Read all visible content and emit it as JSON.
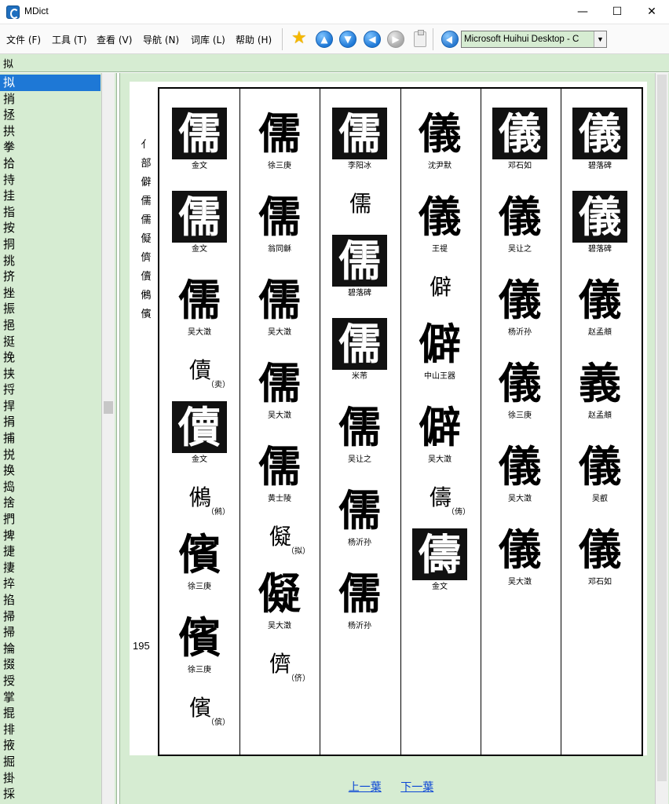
{
  "window": {
    "title": "MDict",
    "min": "—",
    "max": "☐",
    "close": "✕"
  },
  "menu": [
    {
      "label": "文件 (F)"
    },
    {
      "label": "工具 (T)"
    },
    {
      "label": "查看 (V)"
    },
    {
      "label": "导航 (N)"
    },
    {
      "label": "词库 (L)"
    },
    {
      "label": "帮助 (H)"
    }
  ],
  "toolbar": {
    "dictionary": "Microsoft Huihui Desktop - C",
    "icons": [
      "star-icon",
      "arrow-up-icon",
      "arrow-down-icon",
      "arrow-left-icon",
      "arrow-right-icon",
      "clipboard-icon",
      "speaker-icon"
    ]
  },
  "search": {
    "value": "拟"
  },
  "word_list": [
    "拟",
    "捎",
    "拯",
    "拱",
    "拳",
    "拾",
    "持",
    "挂",
    "指",
    "按",
    "挏",
    "挑",
    "挤",
    "挫",
    "振",
    "挹",
    "挺",
    "挽",
    "挟",
    "捋",
    "捍",
    "捐",
    "捕",
    "捝",
    "换",
    "捣",
    "捨",
    "捫",
    "捭",
    "捷",
    "捿",
    "捽",
    "掐",
    "掃",
    "掃",
    "掄",
    "掇",
    "授",
    "掌",
    "掍",
    "排",
    "掖",
    "掘",
    "掛",
    "採"
  ],
  "page": {
    "side_label": [
      "亻",
      "部",
      "僻",
      "儒",
      "儒",
      "儗",
      "儕",
      "儥",
      "鵂",
      "儐"
    ],
    "page_number": "195",
    "columns": [
      {
        "glyphs": [
          {
            "char": "儒",
            "caption": "金文",
            "boxed": true
          },
          {
            "char": "儒",
            "caption": "金文",
            "boxed": true
          },
          {
            "char": "儒",
            "caption": "吴大澂",
            "boxed": false
          }
        ],
        "variants1": {
          "char": "儥",
          "note": "（卖）"
        },
        "glyphs2": [
          {
            "char": "儥",
            "caption": "金文",
            "boxed": true
          }
        ],
        "variants2": {
          "char": "鵂",
          "note": "（鸺）"
        },
        "glyphs3": [
          {
            "char": "儐",
            "caption": "徐三庚",
            "boxed": false
          },
          {
            "char": "儐",
            "caption": "徐三庚",
            "boxed": false
          }
        ],
        "variants3": {
          "char": "儐",
          "note": "（傧）"
        }
      },
      {
        "glyphs": [
          {
            "char": "儒",
            "caption": "徐三庚"
          },
          {
            "char": "儒",
            "caption": "翁同龢"
          },
          {
            "char": "儒",
            "caption": "吴大澂"
          },
          {
            "char": "儒",
            "caption": "吴大澂"
          },
          {
            "char": "儒",
            "caption": "黄士陵"
          }
        ],
        "variants1": {
          "char": "儗",
          "note": "（拟）"
        },
        "glyphs2": [
          {
            "char": "儗",
            "caption": "吴大澂"
          }
        ],
        "variants2": {
          "char": "儕",
          "note": "（侪）"
        }
      },
      {
        "glyphs": [
          {
            "char": "儒",
            "caption": "李阳冰",
            "boxed": true
          }
        ],
        "variants1": {
          "char": "儒",
          "note": ""
        },
        "glyphs2": [
          {
            "char": "儒",
            "caption": "碧落碑",
            "boxed": true
          },
          {
            "char": "儒",
            "caption": "米芾",
            "boxed": true
          },
          {
            "char": "儒",
            "caption": "吴让之"
          },
          {
            "char": "儒",
            "caption": "杨沂孙"
          },
          {
            "char": "儒",
            "caption": "杨沂孙"
          }
        ]
      },
      {
        "glyphs": [
          {
            "char": "儀",
            "caption": "沈尹默"
          },
          {
            "char": "儀",
            "caption": "王禔"
          }
        ],
        "variants1": {
          "char": "僻",
          "note": ""
        },
        "glyphs2": [
          {
            "char": "僻",
            "caption": "中山王器"
          },
          {
            "char": "僻",
            "caption": "吴大澂"
          }
        ],
        "variants2": {
          "char": "儔",
          "note": "（俦）"
        },
        "glyphs3": [
          {
            "char": "儔",
            "caption": "金文",
            "boxed": true
          }
        ]
      },
      {
        "glyphs": [
          {
            "char": "儀",
            "caption": "邓石如",
            "boxed": true
          },
          {
            "char": "儀",
            "caption": "吴让之"
          },
          {
            "char": "儀",
            "caption": "杨沂孙"
          },
          {
            "char": "儀",
            "caption": "徐三庚"
          },
          {
            "char": "儀",
            "caption": "吴大澂"
          },
          {
            "char": "儀",
            "caption": "吴大澂"
          }
        ]
      },
      {
        "glyphs": [
          {
            "char": "儀",
            "caption": "碧落碑",
            "boxed": true
          },
          {
            "char": "儀",
            "caption": "碧落碑",
            "boxed": true
          },
          {
            "char": "儀",
            "caption": "赵孟頫"
          },
          {
            "char": "義",
            "caption": "赵孟頫"
          },
          {
            "char": "儀",
            "caption": "吴叡"
          },
          {
            "char": "儀",
            "caption": "邓石如"
          }
        ]
      }
    ]
  },
  "pager": {
    "prev": "上一葉",
    "next": "下一葉"
  }
}
